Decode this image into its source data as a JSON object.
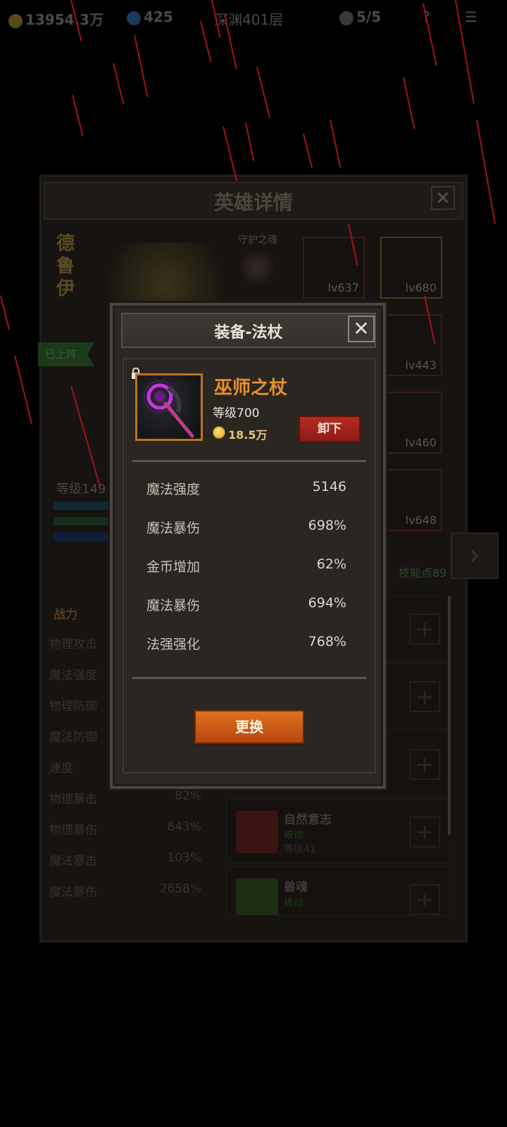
{
  "top_bar": {
    "gold": "13954.3万",
    "gems": "425",
    "floor": "深渊401层",
    "skulls": "5/5"
  },
  "hero_panel": {
    "title": "英雄详情",
    "close": "✕",
    "hero_name": "德鲁伊",
    "guard_label": "守护之魂",
    "deployed_label": "已上阵",
    "hero_level": "等级149",
    "skill_points": "技能点89",
    "next_arrow": "›",
    "equipment_slots": [
      {
        "level": "lv637"
      },
      {
        "level": "lv680"
      },
      {
        "level": "lv443"
      },
      {
        "level": "lv460"
      },
      {
        "level": "lv648"
      }
    ],
    "combat_label": "战力",
    "stats": [
      {
        "name": "物理攻击",
        "value": ""
      },
      {
        "name": "魔法强度",
        "value": ""
      },
      {
        "name": "物理防御",
        "value": ""
      },
      {
        "name": "魔法防御",
        "value": ""
      },
      {
        "name": "速度",
        "value": ""
      },
      {
        "name": "物理暴击",
        "value": "82%"
      },
      {
        "name": "物理暴伤",
        "value": "843%"
      },
      {
        "name": "魔法暴击",
        "value": "103%"
      },
      {
        "name": "魔法暴伤",
        "value": "2658%"
      }
    ],
    "skills": [
      {
        "name": "",
        "type": "",
        "level": ""
      },
      {
        "name": "",
        "type": "",
        "level": ""
      },
      {
        "name": "",
        "type": "",
        "level": ""
      },
      {
        "name": "自然意志",
        "type": "被动",
        "level": "等级41"
      },
      {
        "name": "兽魂",
        "type": "被动",
        "level": ""
      }
    ]
  },
  "equip_dialog": {
    "title": "装备-法杖",
    "close": "✕",
    "item_name": "巫师之杖",
    "item_level": "等级700",
    "item_price": "18.5万",
    "unequip_label": "卸下",
    "attributes": [
      {
        "name": "魔法强度",
        "value": "5146"
      },
      {
        "name": "魔法暴伤",
        "value": "698%"
      },
      {
        "name": "金币增加",
        "value": "62%"
      },
      {
        "name": "魔法暴伤",
        "value": "694%"
      },
      {
        "name": "法强强化",
        "value": "768%"
      }
    ],
    "swap_label": "更换"
  },
  "colors": {
    "item_name": "#e8902e",
    "unequip_button": "#b52a20",
    "swap_button": "#e0701e",
    "item_frame": "#b8761e"
  }
}
